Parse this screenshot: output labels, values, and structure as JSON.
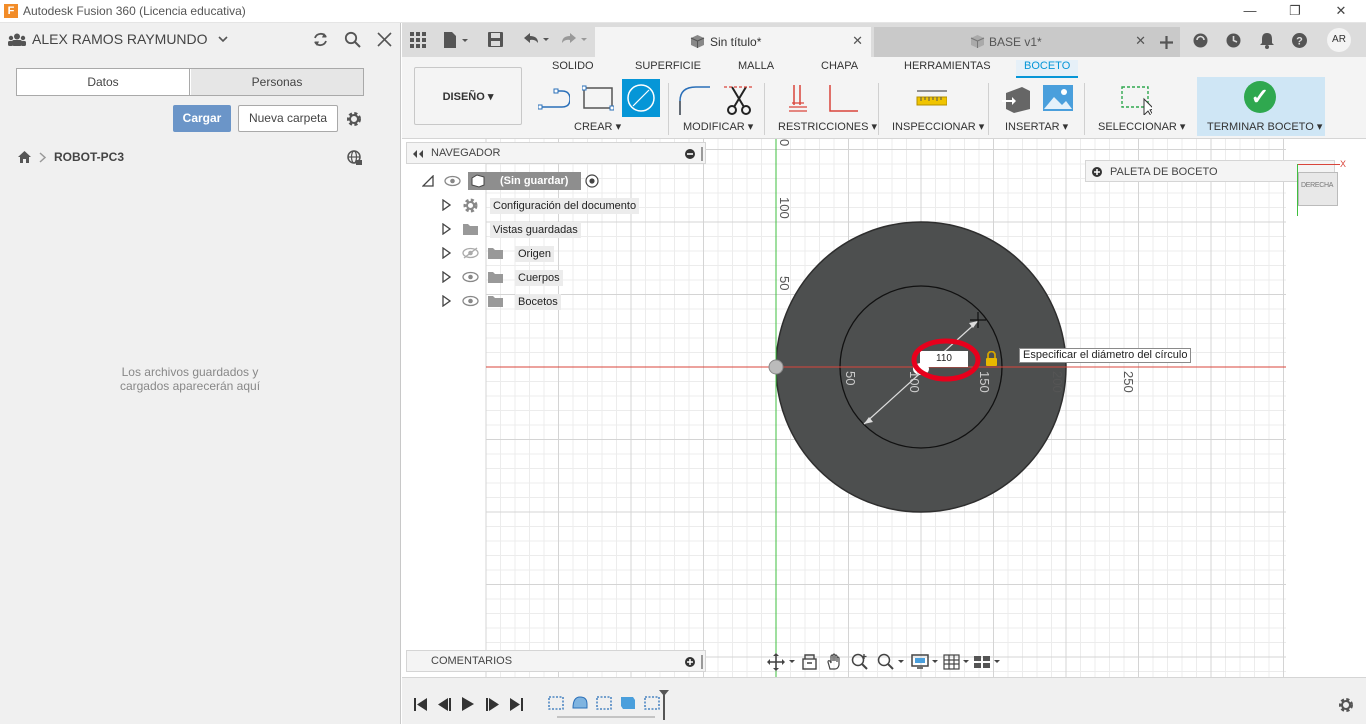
{
  "window": {
    "title": "Autodesk Fusion 360 (Licencia educativa)",
    "logo_letter": "F",
    "minimize": "—",
    "restore": "❐",
    "close": "✕"
  },
  "data_panel": {
    "user_name": "ALEX RAMOS RAYMUNDO",
    "tabs": [
      "Datos",
      "Personas"
    ],
    "upload_label": "Cargar",
    "new_folder_label": "Nueva carpeta",
    "breadcrumb": "ROBOT-PC3",
    "empty_message_line1": "Los archivos guardados y",
    "empty_message_line2": "cargados aparecerán aquí"
  },
  "doc_tabs": {
    "active": "Sin título*",
    "other": "BASE v1*",
    "user_initials": "AR"
  },
  "ribbon": {
    "mode": "DISEÑO",
    "tabs": [
      "SOLIDO",
      "SUPERFICIE",
      "MALLA",
      "CHAPA",
      "HERRAMIENTAS",
      "BOCETO"
    ],
    "active_tab": "BOCETO",
    "groups": {
      "create": "CREAR",
      "modify": "MODIFICAR",
      "constraints": "RESTRICCIONES",
      "inspect": "INSPECCIONAR",
      "insert": "INSERTAR",
      "select": "SELECCIONAR",
      "finish": "TERMINAR BOCETO"
    }
  },
  "navigator": {
    "header": "NAVEGADOR",
    "root": "(Sin guardar)",
    "items": [
      "Configuración del documento",
      "Vistas guardadas",
      "Origen",
      "Cuerpos",
      "Bocetos"
    ]
  },
  "comments": {
    "header": "COMENTARIOS"
  },
  "palette": {
    "header": "PALETA DE BOCETO"
  },
  "viewcube": {
    "face": "DERECHA",
    "axis_x": "X"
  },
  "sketch": {
    "tooltip": "Especificar el diámetro del círculo",
    "diameter_input": "110",
    "axis_labels": {
      "v0": "0",
      "v100": "100",
      "v50": "50",
      "h50": "50",
      "h100": "100",
      "h150": "150",
      "h200": "200",
      "h250": "250"
    }
  },
  "colors": {
    "accent": "#0696d7",
    "sketch_fill": "#4d4f4f",
    "highlight_ring": "#e8001c",
    "x_axis": "#d9453b",
    "y_axis": "#3fbf3f",
    "finish_green": "#2fa84f"
  }
}
